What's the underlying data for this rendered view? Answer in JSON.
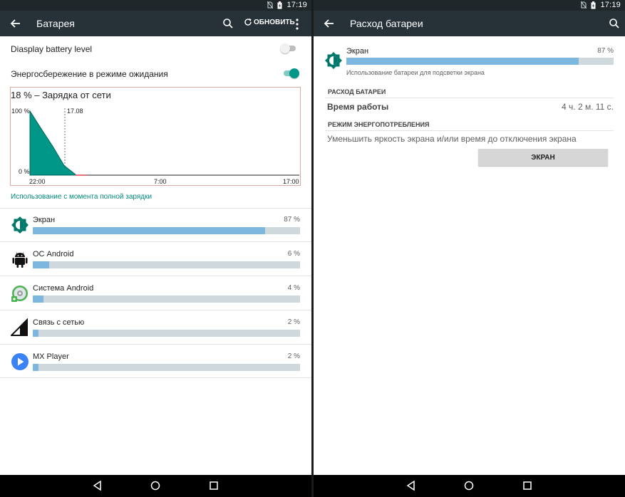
{
  "colors": {
    "appbar": "#263238",
    "statusbar": "#1f272a",
    "accent": "#00897b",
    "chart_fill": "#009688",
    "bar_fill": "#7cb7e0",
    "bar_track": "#cfd8dc"
  },
  "left": {
    "status": {
      "time": "17:19",
      "icons": [
        "no-sim-icon",
        "battery-charging-icon"
      ]
    },
    "appbar": {
      "title": "Батарея",
      "refresh_label": "ОБНОВИТЬ",
      "icons": [
        "back-arrow-icon",
        "search-icon",
        "refresh-icon",
        "more-vert-icon"
      ]
    },
    "settings": [
      {
        "label": "Diasplay battery level",
        "on": false
      },
      {
        "label": "Энергосбережение в режиме ожидания",
        "on": true
      }
    ],
    "chart_data": {
      "type": "area",
      "title": "18 % – Зарядка от сети",
      "y_labels": [
        "100 %",
        "0 %"
      ],
      "x_labels": [
        "22:00",
        "7:00",
        "17:00"
      ],
      "marker_label": "17.08",
      "ylim": [
        0,
        100
      ],
      "x": [
        "22:00",
        "22:30",
        "23:00",
        "23:30",
        "00:00"
      ],
      "values": [
        100,
        72,
        45,
        15,
        1
      ],
      "grid": false
    },
    "section_link": "Использование с момента полной зарядки",
    "usage": [
      {
        "name": "Экран",
        "percent_label": "87 %",
        "percent": 87,
        "icon": "screen-brightness-icon"
      },
      {
        "name": "ОС Android",
        "percent_label": "6 %",
        "percent": 6,
        "icon": "android-robot-icon"
      },
      {
        "name": "Система Android",
        "percent_label": "4 %",
        "percent": 4,
        "icon": "android-system-icon"
      },
      {
        "name": "Связь с сетью",
        "percent_label": "2 %",
        "percent": 2,
        "icon": "cell-signal-icon"
      },
      {
        "name": "MX Player",
        "percent_label": "2 %",
        "percent": 2,
        "icon": "play-circle-icon"
      }
    ],
    "nav": [
      "back-triangle-icon",
      "home-circle-icon",
      "recents-square-icon"
    ]
  },
  "right": {
    "status": {
      "time": "17:19"
    },
    "appbar": {
      "title": "Расход батареи"
    },
    "detail": {
      "name": "Экран",
      "percent_label": "87 %",
      "percent": 87,
      "description": "Использование батареи для подсветки экрана"
    },
    "usage_section": {
      "header": "РАСХОД БАТАРЕИ",
      "uptime_label": "Время работы",
      "uptime_value": "4 ч. 2 м. 11 с."
    },
    "power_section": {
      "header": "РЕЖИМ ЭНЕРГОПОТРЕБЛЕНИЯ",
      "text": "Уменьшить яркость экрана и/или время до отключения экрана",
      "button_label": "ЭКРАН"
    }
  }
}
